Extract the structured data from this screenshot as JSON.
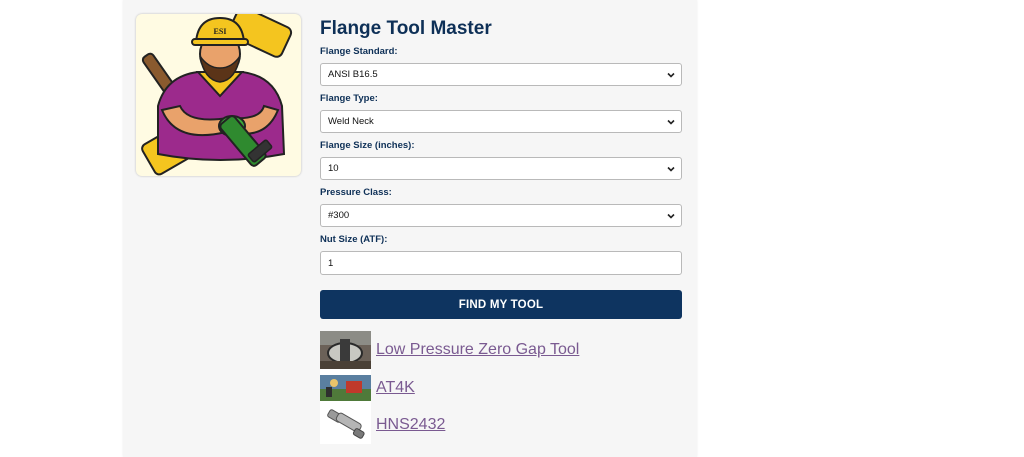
{
  "app": {
    "title": "Flange Tool Master"
  },
  "mascot": {
    "icon": "construction-worker-mascot",
    "hat_text": "ESI"
  },
  "form": {
    "flange_standard": {
      "label": "Flange Standard:",
      "value": "ANSI B16.5"
    },
    "flange_type": {
      "label": "Flange Type:",
      "value": "Weld Neck"
    },
    "flange_size": {
      "label": "Flange Size (inches):",
      "value": "10"
    },
    "pressure_class": {
      "label": "Pressure Class:",
      "value": "#300"
    },
    "nut_size": {
      "label": "Nut Size (ATF):",
      "value": "1"
    },
    "submit_label": "FIND MY TOOL"
  },
  "results": [
    {
      "label": "Low Pressure Zero Gap Tool",
      "thumb": "machine-photo"
    },
    {
      "label": "AT4K",
      "thumb": "site-photo"
    },
    {
      "label": "HNS2432",
      "thumb": "tool-photo"
    }
  ],
  "colors": {
    "primary": "#0e3460",
    "heading": "#0e3057",
    "link": "#7a5a91",
    "panel_bg": "#f6f6f6"
  }
}
